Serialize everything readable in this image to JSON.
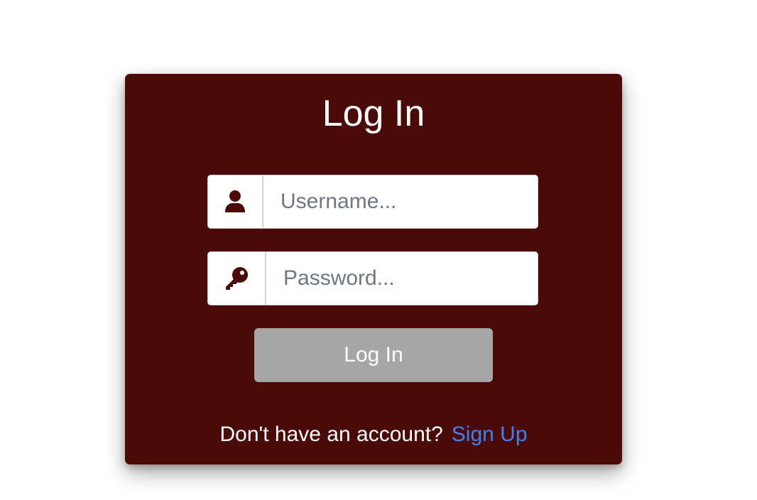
{
  "colors": {
    "card_background": "#4a0a07",
    "icon": "#4a0a07",
    "button_background": "#a6a6a6",
    "link": "#3b82f6"
  },
  "form": {
    "title": "Log In",
    "username": {
      "icon": "user-icon",
      "placeholder": "Username...",
      "value": ""
    },
    "password": {
      "icon": "key-icon",
      "placeholder": "Password...",
      "value": ""
    },
    "submit_label": "Log In",
    "signup_prompt": "Don't have an account?",
    "signup_link": "Sign Up"
  }
}
